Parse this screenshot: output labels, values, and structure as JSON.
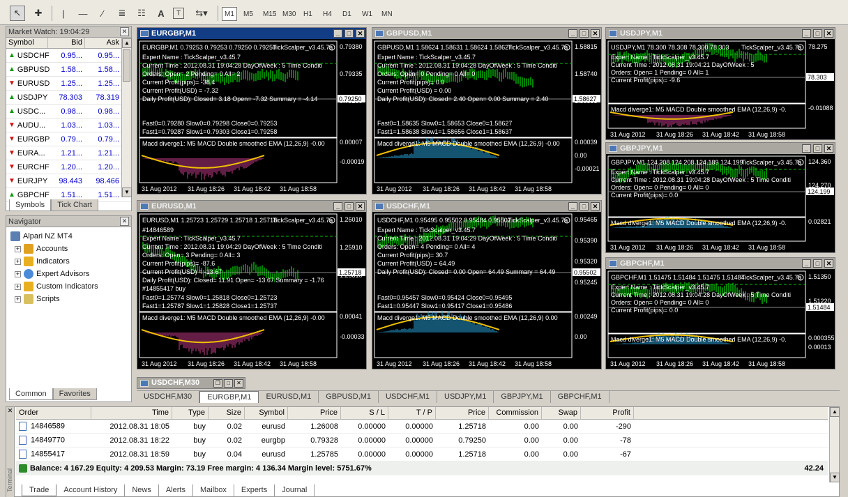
{
  "toolbar": {
    "tools": [
      "cursor-icon",
      "crosshair-icon",
      "vertical-line-icon",
      "horizontal-line-icon",
      "trendline-icon",
      "fibo-icon",
      "gann-icon",
      "text-icon",
      "label-icon",
      "arrows-icon"
    ],
    "tool_text": "A",
    "tool_label": "T",
    "timeframes": [
      "M1",
      "M5",
      "M15",
      "M30",
      "H1",
      "H4",
      "D1",
      "W1",
      "MN"
    ],
    "active_timeframe": "M1"
  },
  "market_watch": {
    "title": "Market Watch: 19:04:29",
    "columns": [
      "Symbol",
      "Bid",
      "Ask"
    ],
    "rows": [
      {
        "symbol": "USDCHF",
        "bid": "0.95...",
        "ask": "0.95...",
        "dir": "up"
      },
      {
        "symbol": "GBPUSD",
        "bid": "1.58...",
        "ask": "1.58...",
        "dir": "up"
      },
      {
        "symbol": "EURUSD",
        "bid": "1.25...",
        "ask": "1.25...",
        "dir": "down"
      },
      {
        "symbol": "USDJPY",
        "bid": "78.303",
        "ask": "78.319",
        "dir": "up"
      },
      {
        "symbol": "USDC...",
        "bid": "0.98...",
        "ask": "0.98...",
        "dir": "up"
      },
      {
        "symbol": "AUDU...",
        "bid": "1.03...",
        "ask": "1.03...",
        "dir": "down"
      },
      {
        "symbol": "EURGBP",
        "bid": "0.79...",
        "ask": "0.79...",
        "dir": "down"
      },
      {
        "symbol": "EURA...",
        "bid": "1.21...",
        "ask": "1.21...",
        "dir": "down"
      },
      {
        "symbol": "EURCHF",
        "bid": "1.20...",
        "ask": "1.20...",
        "dir": "down"
      },
      {
        "symbol": "EURJPY",
        "bid": "98.443",
        "ask": "98.466",
        "dir": "down"
      },
      {
        "symbol": "GBPCHF",
        "bid": "1.51...",
        "ask": "1.51...",
        "dir": "up"
      }
    ],
    "tabs": [
      "Symbols",
      "Tick Chart"
    ]
  },
  "navigator": {
    "title": "Navigator",
    "root": "Alpari NZ MT4",
    "items": [
      "Accounts",
      "Indicators",
      "Expert Advisors",
      "Custom Indicators",
      "Scripts"
    ],
    "tabs": [
      "Common",
      "Favorites"
    ]
  },
  "charts": [
    {
      "title": "EURGBP,M1",
      "header": "EURGBP,M1  0.79253 0.79253 0.79250 0.79250",
      "ea": "TickScalper_v3.45.7a",
      "price": "0.79250",
      "lines": [
        "Expert Name : TickScalper_v3.45.7",
        "Current Time : 2012.08.31 19:04:28 DayOfWeek : 5 Time Conditi",
        "Orders: Open= 2 Pending= 0 All= 2",
        "Current Profit(pips)= -38.4",
        "Current Profit(USD) = -7.32",
        "Daily Profit(USD): Closed= 3.18 Open= -7.32 Summary = -4.14"
      ],
      "fast": [
        "Fast0=0.79280 Slow0=0.79298 Close0=0.79253",
        "Fast1=0.79287 Slow1=0.79303 Close1=0.79258"
      ],
      "axis": [
        "0.79380",
        "0.79335",
        "0.79290"
      ],
      "macd": "Macd diverge1: M5 MACD Double smoothed EMA (12,26,9) -0.00",
      "macd_axis": [
        "0.00007",
        "-0.00019"
      ],
      "times": [
        "31 Aug 2012",
        "31 Aug 18:26",
        "31 Aug 18:42",
        "31 Aug 18:58"
      ],
      "hist": "#c83c8c"
    },
    {
      "title": "GBPUSD,M1",
      "header": "GBPUSD,M1  1.58624 1.58631 1.58624 1.58627",
      "ea": "TickScalper_v3.45.7a",
      "price": "1.58627",
      "lines": [
        "Expert Name : TickScalper_v3.45.7",
        "Current Time : 2012.08.31 19:04:28 DayOfWeek : 5 Time Conditi",
        "Orders: Open= 0 Pending= 0 All= 0",
        "Current Profit(pips)= 0.0",
        "Current Profit(USD) = 0.00",
        "Daily Profit(USD): Closed= 2.40 Open= 0.00 Summary = 2.40"
      ],
      "fast": [
        "Fast0=1.58635 Slow0=1.58653 Close0=1.58627",
        "Fast1=1.58638 Slow1=1.58656 Close1=1.58637"
      ],
      "axis": [
        "1.58815",
        "1.58740",
        "1.58595"
      ],
      "macd": "Macd diverge1: M5 MACD Double smoothed EMA (12,26,9) -0.00",
      "macd_axis": [
        "0.00039",
        "0.00",
        "-0.00021"
      ],
      "times": [
        "31 Aug 2012",
        "31 Aug 18:26",
        "31 Aug 18:42",
        "31 Aug 18:58"
      ],
      "hist": "#2aa8e0"
    },
    {
      "title": "USDJPY,M1",
      "header": "USDJPY,M1  78.300 78.308 78.300 78.303",
      "ea": "TickScalper_v3.45.7a",
      "price": "78.303",
      "lines": [
        "Expert Name : TickScalper_v3.45.7",
        "Current Time : 2012.08.31 19:04:21 DayOfWeek : 5",
        "Orders: Open= 1 Pending= 0 All= 1",
        "Current Profit(pips)= -9.6"
      ],
      "fast": [],
      "axis": [
        "78.275"
      ],
      "macd": "Macd diverge1: M5 MACD Double smoothed EMA (12,26,9) -0.",
      "macd_axis": [
        "-0.01088"
      ],
      "times": [
        "31 Aug 2012",
        "31 Aug 18:26",
        "31 Aug 18:42",
        "31 Aug 18:58"
      ],
      "hist": "#c83c8c"
    },
    {
      "title": "GBPJPY,M1",
      "header": "GBPJPY,M1  124.208 124.208 124.189 124.199",
      "ea": "TickScalper_v3.45.7a",
      "price": "124.199",
      "lines": [
        "Expert Name : TickScalper_v3.45.7",
        "Current Time : 2012.08.31 19:04:28 DayOfWeek : 5 Time Conditi",
        "Orders: Open= 0 Pending= 0 All= 0",
        "Current Profit(pips)= 0.0"
      ],
      "fast": [],
      "axis": [
        "124.360",
        "124.270"
      ],
      "macd": "Macd diverge1: M5 MACD Double smoothed EMA (12,26,9) -0.",
      "macd_axis": [
        "0.02821"
      ],
      "times": [
        "31 Aug 2012",
        "31 Aug 18:26",
        "31 Aug 18:42",
        "31 Aug 18:58"
      ],
      "hist": "#2aa8e0"
    },
    {
      "title": "EURUSD,M1",
      "header": "EURUSD,M1  1.25723 1.25729 1.25718 1.25718",
      "ea": "TickScalper_v3.45.7a",
      "price": "1.25718",
      "lines": [
        "#14846589",
        "Expert Name : TickScalper_v3.45.7",
        "Current Time : 2012.08.31 19:04:29 DayOfWeek : 5 Time Conditi",
        "Orders: Open= 3 Pending= 0 All= 3",
        "Current Profit(pips)= -87.6",
        "Current Profit(USD) = -13.67",
        "Daily Profit(USD): Closed= 11.91 Open= -13.67 Summary = -1.76",
        "#14855417 buy"
      ],
      "fast": [
        "Fast0=1.25774 Slow0=1.25818 Close0=1.25723",
        "Fast1=1.25787 Slow1=1.25828 Close1=1.25737"
      ],
      "axis": [
        "1.26010",
        "1.25910",
        "1.25810"
      ],
      "macd": "Macd diverge1: M5 MACD Double smoothed EMA (12,26,9) -0.00",
      "macd_axis": [
        "0.00041",
        "-0.00033"
      ],
      "times": [
        "31 Aug 2012",
        "31 Aug 18:26",
        "31 Aug 18:42",
        "31 Aug 18:58"
      ],
      "hist": "#c83c8c"
    },
    {
      "title": "USDCHF,M1",
      "header": "USDCHF,M1  0.95495 0.95502 0.95484 0.95502",
      "ea": "TickScalper_v3.45.7a",
      "price": "0.95502",
      "lines": [
        "Expert Name : TickScalper_v3.45.7",
        "Current Time : 2012.08.31 19:04:29 DayOfWeek : 5 Time Conditi",
        "Orders: Open= 4 Pending= 0 All= 4",
        "Current Profit(pips)= 30.7",
        "Current Profit(USD) = 64.49",
        "Daily Profit(USD): Closed= 0.00 Open= 64.49 Summary = 64.49"
      ],
      "fast": [
        "Fast0=0.95457 Slow0=0.95424 Close0=0.95495",
        "Fast1=0.95447 Slow1=0.95417 Close1=0.95486"
      ],
      "axis": [
        "0.95465",
        "0.95390",
        "0.95320",
        "0.95245"
      ],
      "macd": "Macd diverge1: M5 MACD Double smoothed EMA (12,26,9) 0.00",
      "macd_axis": [
        "0.00249",
        "0.00"
      ],
      "times": [
        "31 Aug 2012",
        "31 Aug 18:26",
        "31 Aug 18:42",
        "31 Aug 18:58"
      ],
      "hist": "#2aa8e0"
    },
    {
      "title": "GBPCHF,M1",
      "header": "GBPCHF,M1  1.51475 1.51484 1.51475 1.51484",
      "ea": "TickScalper_v3.45.7a",
      "price": "1.51484",
      "lines": [
        "Expert Name : TickScalper_v3.45.7",
        "Current Time : 2012.08.31 19:04:28 DayOfWeek : 5 Time Conditi",
        "Orders: Open= 0 Pending= 0 All= 0",
        "Current Profit(pips)= 0.0"
      ],
      "fast": [],
      "axis": [
        "1.51350",
        "1.51220"
      ],
      "macd": "Macd diverge1: M5 MACD Double smoothed EMA (12,26,9) -0.",
      "macd_axis": [
        "0.000355",
        "0.00013"
      ],
      "times": [
        "31 Aug 2012",
        "31 Aug 18:26",
        "31 Aug 18:42",
        "31 Aug 18:58"
      ],
      "hist": "#2aa8e0"
    }
  ],
  "minimized_chart": "USDCHF,M30",
  "chart_tabs": [
    "USDCHF,M30",
    "EURGBP,M1",
    "EURUSD,M1",
    "GBPUSD,M1",
    "USDCHF,M1",
    "USDJPY,M1",
    "GBPJPY,M1",
    "GBPCHF,M1"
  ],
  "active_chart_tab": "EURGBP,M1",
  "terminal": {
    "columns": [
      "Order",
      "Time",
      "Type",
      "Size",
      "Symbol",
      "Price",
      "S / L",
      "T / P",
      "Price",
      "Commission",
      "Swap",
      "Profit"
    ],
    "rows": [
      [
        "14846589",
        "2012.08.31 18:05",
        "buy",
        "0.02",
        "eurusd",
        "1.26008",
        "0.00000",
        "0.00000",
        "1.25718",
        "0.00",
        "0.00",
        "-290"
      ],
      [
        "14849770",
        "2012.08.31 18:22",
        "buy",
        "0.02",
        "eurgbp",
        "0.79328",
        "0.00000",
        "0.00000",
        "0.79250",
        "0.00",
        "0.00",
        "-78"
      ],
      [
        "14855417",
        "2012.08.31 18:59",
        "buy",
        "0.04",
        "eurusd",
        "1.25785",
        "0.00000",
        "0.00000",
        "1.25718",
        "0.00",
        "0.00",
        "-67"
      ]
    ],
    "balance": "Balance: 4 167.29  Equity: 4 209.53  Margin: 73.19  Free margin: 4 136.34  Margin level: 5751.67%",
    "total": "42.24",
    "tabs": [
      "Trade",
      "Account History",
      "News",
      "Alerts",
      "Mailbox",
      "Experts",
      "Journal"
    ],
    "side_label": "Terminal"
  }
}
